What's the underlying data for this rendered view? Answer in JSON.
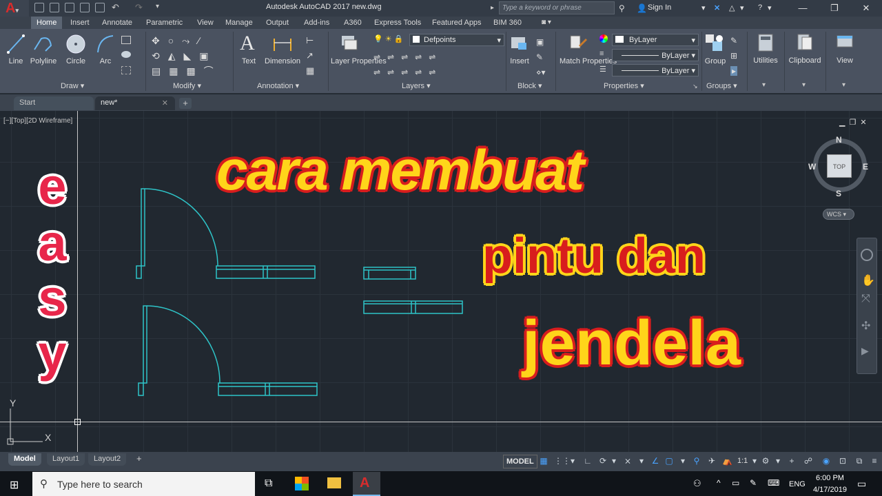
{
  "window": {
    "title": "Autodesk AutoCAD 2017    new.dwg",
    "search_placeholder": "Type a keyword or phrase",
    "sign_in": "Sign In"
  },
  "ribbon_tabs": [
    "Home",
    "Insert",
    "Annotate",
    "Parametric",
    "View",
    "Manage",
    "Output",
    "Add-ins",
    "A360",
    "Express Tools",
    "Featured Apps",
    "BIM 360"
  ],
  "draw": {
    "title": "Draw",
    "line": "Line",
    "polyline": "Polyline",
    "circle": "Circle",
    "arc": "Arc"
  },
  "modify": {
    "title": "Modify"
  },
  "annotation": {
    "title": "Annotation",
    "text": "Text",
    "dimension": "Dimension"
  },
  "layers": {
    "title": "Layers",
    "layer_properties": "Layer Properties",
    "current_layer": "Defpoints"
  },
  "block": {
    "title": "Block",
    "insert": "Insert"
  },
  "properties": {
    "title": "Properties",
    "match": "Match Properties",
    "color": "ByLayer",
    "linetype": "ByLayer",
    "lineweight": "ByLayer"
  },
  "groups": {
    "title": "Groups",
    "group": "Group"
  },
  "utilities": "Utilities",
  "clipboard": "Clipboard",
  "view_panel": "View",
  "file_tabs": {
    "start": "Start",
    "new": "new*"
  },
  "viewport": {
    "label": "[−][Top][2D Wireframe]",
    "easy": [
      "e",
      "a",
      "s",
      "y"
    ],
    "headline1": "cara membuat",
    "headline2": "pintu dan",
    "headline3": "jendela",
    "viewcube": {
      "n": "N",
      "s": "S",
      "e": "E",
      "w": "W",
      "top": "TOP",
      "wcs": "WCS"
    },
    "ucs": {
      "x": "X",
      "y": "Y"
    }
  },
  "layout_tabs": [
    "Model",
    "Layout1",
    "Layout2"
  ],
  "status": {
    "model": "MODEL",
    "scale": "1:1"
  },
  "taskbar": {
    "search": "Type here to search",
    "lang": "ENG",
    "time": "6:00 PM",
    "date": "4/17/2019"
  },
  "colors": {
    "accent_cyan": "#2ec4c8",
    "title_yellow": "#ffd51a",
    "title_red": "#d81d1d",
    "easy_pink": "#e8264a"
  }
}
